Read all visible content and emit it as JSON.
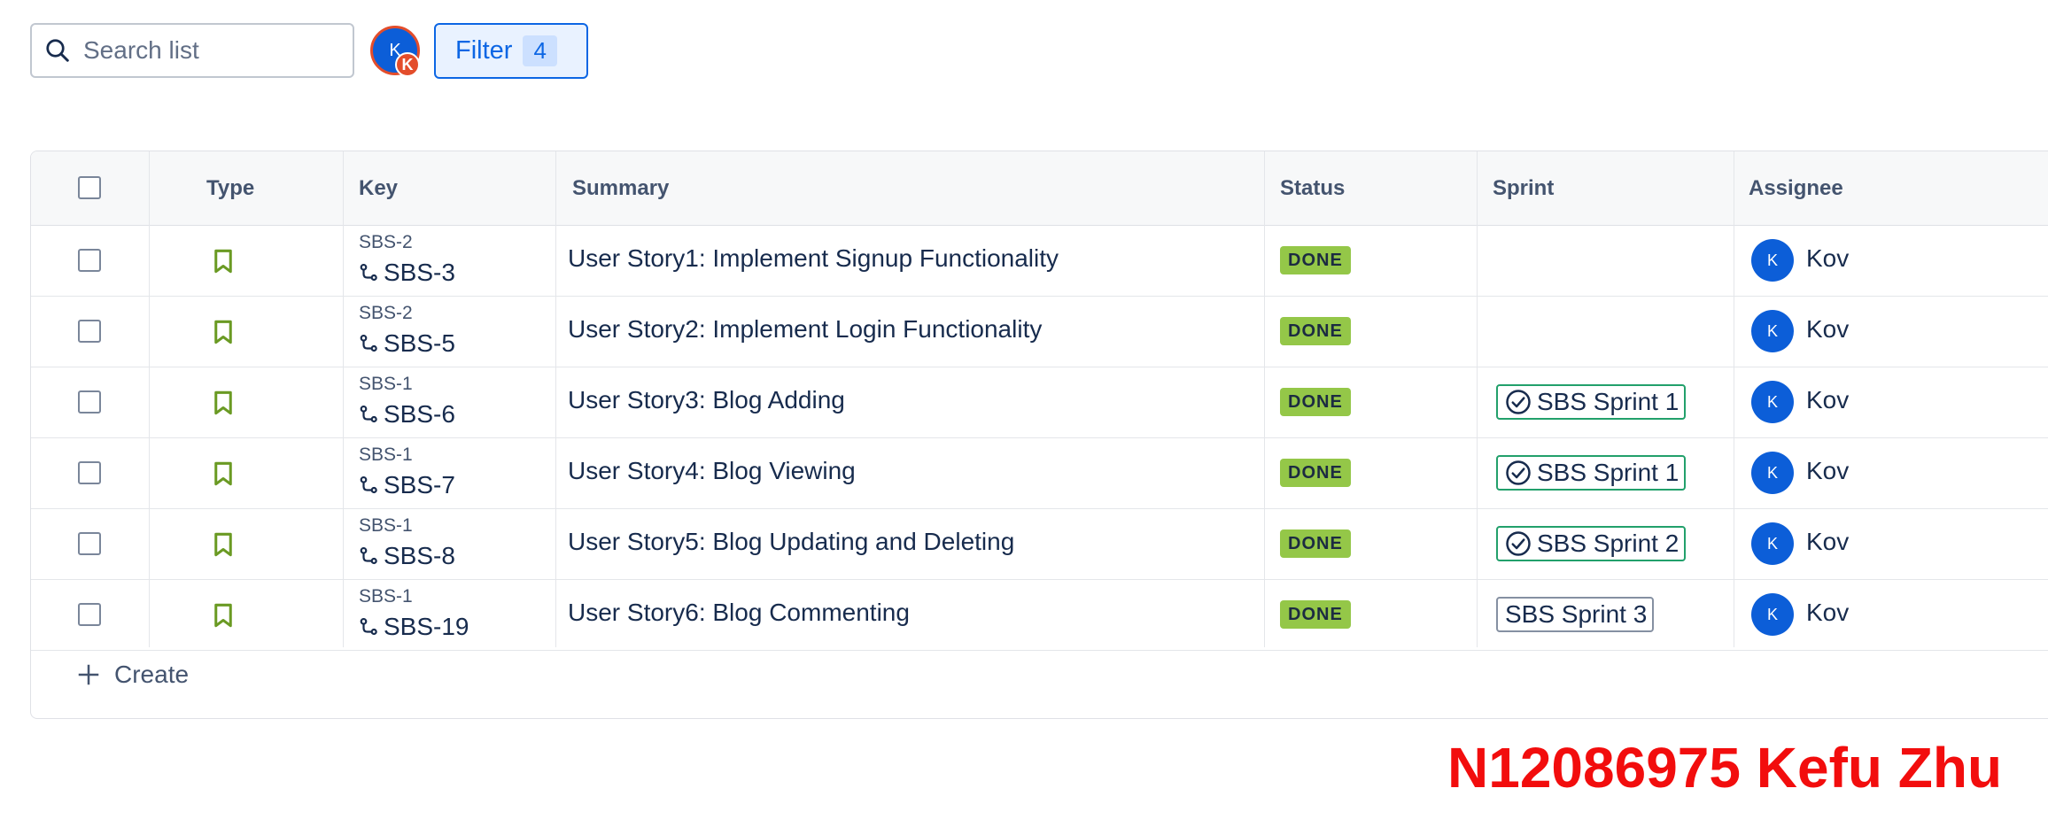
{
  "toolbar": {
    "search_placeholder": "Search list",
    "avatar_initial": "K",
    "avatar_badge": "K",
    "filter_label": "Filter",
    "filter_count": "4"
  },
  "table": {
    "columns": [
      "Type",
      "Key",
      "Summary",
      "Status",
      "Sprint",
      "Assignee"
    ],
    "rows": [
      {
        "parent": "SBS-2",
        "key": "SBS-3",
        "summary": "User Story1: Implement Signup Functionality",
        "status": "DONE",
        "sprint": "",
        "assignee_initial": "K",
        "assignee": "Kov"
      },
      {
        "parent": "SBS-2",
        "key": "SBS-5",
        "summary": "User Story2: Implement Login Functionality",
        "status": "DONE",
        "sprint": "",
        "assignee_initial": "K",
        "assignee": "Kov"
      },
      {
        "parent": "SBS-1",
        "key": "SBS-6",
        "summary": "User Story3: Blog Adding",
        "status": "DONE",
        "sprint": "SBS Sprint 1",
        "assignee_initial": "K",
        "assignee": "Kov"
      },
      {
        "parent": "SBS-1",
        "key": "SBS-7",
        "summary": "User Story4: Blog Viewing",
        "status": "DONE",
        "sprint": "SBS Sprint 1",
        "assignee_initial": "K",
        "assignee": "Kov"
      },
      {
        "parent": "SBS-1",
        "key": "SBS-8",
        "summary": "User Story5: Blog Updating and Deleting",
        "status": "DONE",
        "sprint": "SBS Sprint 2",
        "assignee_initial": "K",
        "assignee": "Kov"
      },
      {
        "parent": "SBS-1",
        "key": "SBS-19",
        "summary": "User Story6: Blog Commenting",
        "status": "DONE",
        "sprint": "SBS Sprint 3",
        "assignee_initial": "K",
        "assignee": "Kov"
      }
    ],
    "create_label": "Create"
  },
  "watermark": "N12086975 Kefu Zhu",
  "colors": {
    "accent": "#0c66e4",
    "status_done": "#94c748",
    "sprint_done_border": "#22a06b",
    "story_icon": "#6a9a23",
    "watermark": "#f20d0d"
  }
}
